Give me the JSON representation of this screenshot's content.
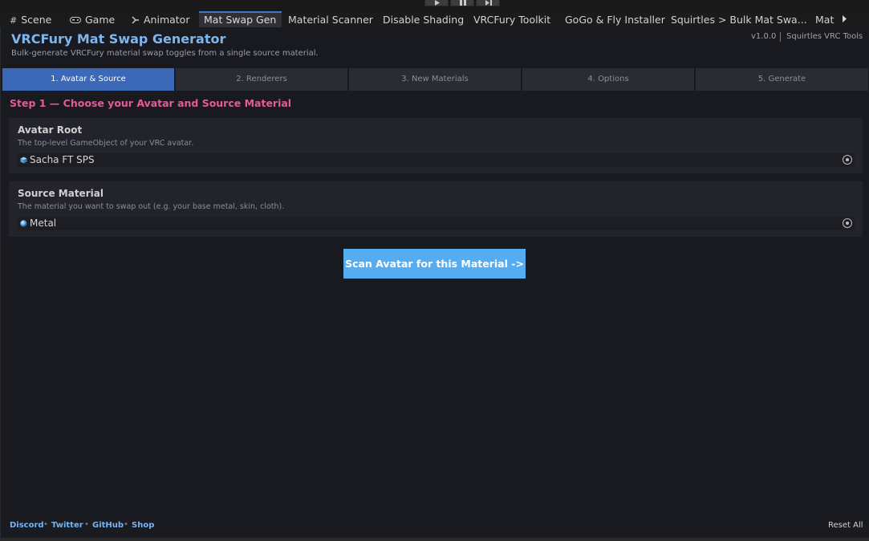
{
  "playbar": {
    "play_icon": "play-icon",
    "pause_icon": "pause-icon",
    "step_icon": "step-icon"
  },
  "tabs": [
    {
      "label": "Scene",
      "icon": "grid-icon"
    },
    {
      "label": "Game",
      "icon": "gamepad-icon"
    },
    {
      "label": "Animator",
      "icon": "animator-icon"
    },
    {
      "label": "Mat Swap Gen",
      "active": true
    },
    {
      "label": "Material Scanner"
    },
    {
      "label": "Disable Shading"
    },
    {
      "label": "VRCFury Toolkit"
    },
    {
      "label": "GoGo & Fly Installer"
    },
    {
      "label": "Squirtles > Bulk Mat Swa..."
    },
    {
      "label": "Mat S"
    }
  ],
  "header": {
    "title": "VRCFury Mat Swap Generator",
    "subtitle": "Bulk-generate VRCFury material swap toggles from a single source material.",
    "version": "v1.0.0",
    "brand": "Squirtles VRC Tools"
  },
  "steps": [
    {
      "label": "1. Avatar & Source",
      "active": true
    },
    {
      "label": "2. Renderers"
    },
    {
      "label": "3. New Materials"
    },
    {
      "label": "4. Options"
    },
    {
      "label": "5. Generate"
    }
  ],
  "step_heading": "Step 1 — Choose your Avatar and Source Material",
  "avatar": {
    "label": "Avatar Root",
    "help": "The top-level GameObject of your VRC avatar.",
    "value": "Sacha FT SPS",
    "icon": "gameobject-icon"
  },
  "material": {
    "label": "Source Material",
    "help": "The material you want to swap out (e.g. your base metal, skin, cloth).",
    "value": "Metal",
    "icon": "material-sphere-icon"
  },
  "scan_button": "Scan Avatar for this Material  ->",
  "footer": {
    "links": [
      "Discord",
      "Twitter",
      "GitHub",
      "Shop"
    ],
    "separator": "•",
    "reset": "Reset All"
  },
  "colors": {
    "accent": "#3b68b7",
    "title": "#7cb6ef",
    "heading": "#e45c96",
    "button": "#56acf0",
    "background": "#191a20"
  }
}
